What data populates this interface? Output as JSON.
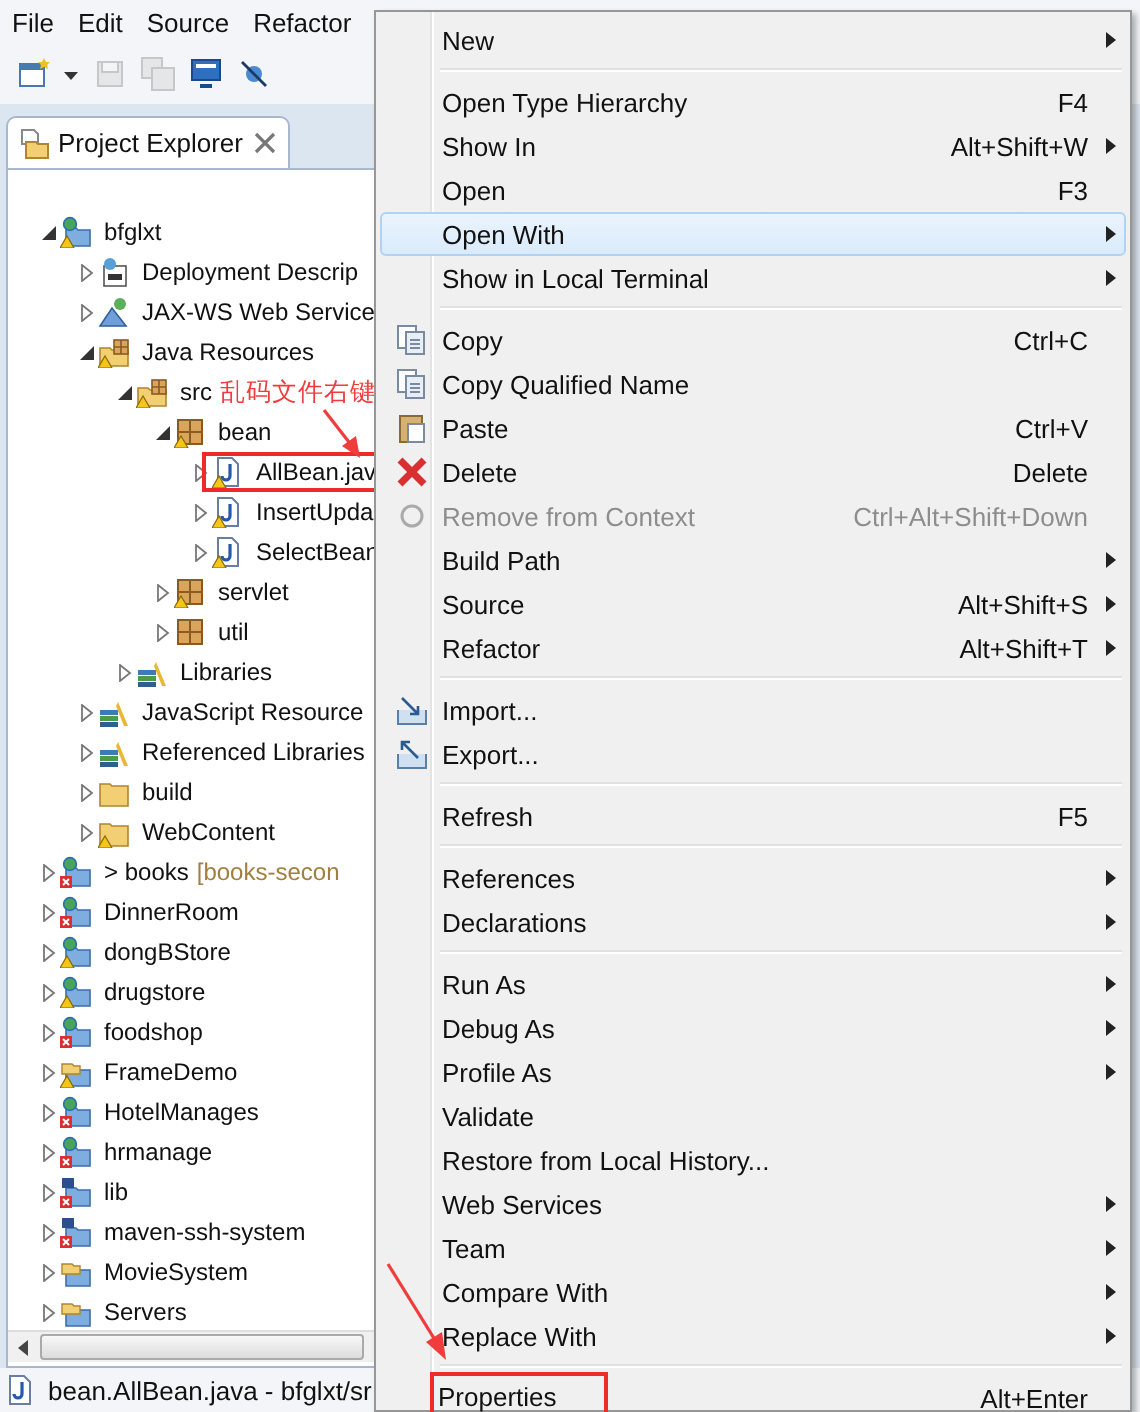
{
  "menubar": [
    "File",
    "Edit",
    "Source",
    "Refactor"
  ],
  "toolbar": [
    {
      "kind": "new",
      "disabled": false
    },
    {
      "kind": "dropdown",
      "disabled": false
    },
    {
      "kind": "save",
      "disabled": true
    },
    {
      "kind": "save-all",
      "disabled": true
    },
    {
      "kind": "monitor",
      "disabled": false
    },
    {
      "kind": "pin",
      "disabled": false
    }
  ],
  "explorer": {
    "tab": "Project Explorer",
    "tree": [
      {
        "label": "bfglxt",
        "kind": "project",
        "warning": true,
        "error": false,
        "expanded": true,
        "marked": false,
        "children": [
          {
            "label": "Deployment Descrip",
            "kind": "deployment",
            "warning": false,
            "error": false,
            "expanded": false,
            "marked": false
          },
          {
            "label": "JAX-WS Web Service",
            "kind": "webservice",
            "warning": false,
            "error": false,
            "expanded": false,
            "marked": false
          },
          {
            "label": "Java Resources",
            "kind": "java-resources",
            "warning": true,
            "error": false,
            "expanded": true,
            "marked": false,
            "children": [
              {
                "label": "src",
                "kind": "source-folder",
                "warning": true,
                "error": false,
                "expanded": true,
                "marked": false,
                "children": [
                  {
                    "label": "bean",
                    "kind": "package",
                    "warning": true,
                    "error": false,
                    "expanded": true,
                    "marked": false,
                    "children": [
                      {
                        "label": "AllBean.jav",
                        "kind": "java-file",
                        "warning": true,
                        "error": false,
                        "expanded": false,
                        "marked": true
                      },
                      {
                        "label": "InsertUpda",
                        "kind": "java-file",
                        "warning": true,
                        "error": false,
                        "expanded": false,
                        "marked": false
                      },
                      {
                        "label": "SelectBean",
                        "kind": "java-file",
                        "warning": true,
                        "error": false,
                        "expanded": false,
                        "marked": false
                      }
                    ]
                  },
                  {
                    "label": "servlet",
                    "kind": "package",
                    "warning": true,
                    "error": false,
                    "expanded": false,
                    "marked": false
                  },
                  {
                    "label": "util",
                    "kind": "package",
                    "warning": false,
                    "error": false,
                    "expanded": false,
                    "marked": false
                  }
                ]
              },
              {
                "label": "Libraries",
                "kind": "library",
                "warning": false,
                "error": false,
                "expanded": false,
                "marked": false
              }
            ]
          },
          {
            "label": "JavaScript Resource",
            "kind": "library",
            "warning": false,
            "error": false,
            "expanded": false,
            "marked": false
          },
          {
            "label": "Referenced Libraries",
            "kind": "library",
            "warning": false,
            "error": false,
            "expanded": false,
            "marked": false
          },
          {
            "label": "build",
            "kind": "folder",
            "warning": false,
            "error": false,
            "expanded": false,
            "marked": false
          },
          {
            "label": "WebContent",
            "kind": "folder",
            "warning": true,
            "error": false,
            "expanded": false,
            "marked": false
          }
        ]
      },
      {
        "label": "> books",
        "decoration": "[books-secon",
        "kind": "project",
        "warning": false,
        "error": true,
        "expanded": false,
        "marked": false
      },
      {
        "label": "DinnerRoom",
        "kind": "project",
        "warning": false,
        "error": true,
        "expanded": false,
        "marked": false
      },
      {
        "label": "dongBStore",
        "kind": "project",
        "warning": true,
        "error": false,
        "expanded": false,
        "marked": false
      },
      {
        "label": "drugstore",
        "kind": "project",
        "warning": true,
        "error": false,
        "expanded": false,
        "marked": false
      },
      {
        "label": "foodshop",
        "kind": "project",
        "warning": false,
        "error": true,
        "expanded": false,
        "marked": false
      },
      {
        "label": "FrameDemo",
        "kind": "plain-project",
        "warning": true,
        "error": false,
        "expanded": false,
        "marked": false
      },
      {
        "label": "HotelManages",
        "kind": "project",
        "warning": false,
        "error": true,
        "expanded": false,
        "marked": false
      },
      {
        "label": "hrmanage",
        "kind": "project",
        "warning": false,
        "error": true,
        "expanded": false,
        "marked": false
      },
      {
        "label": "lib",
        "kind": "maven-project",
        "warning": false,
        "error": true,
        "expanded": false,
        "marked": false
      },
      {
        "label": "maven-ssh-system",
        "kind": "maven-project",
        "warning": false,
        "error": true,
        "expanded": false,
        "marked": false
      },
      {
        "label": "MovieSystem",
        "kind": "plain-project",
        "warning": false,
        "error": false,
        "expanded": false,
        "marked": false
      },
      {
        "label": "Servers",
        "kind": "plain-project",
        "warning": false,
        "error": false,
        "expanded": false,
        "marked": false
      }
    ]
  },
  "context_menu": {
    "items": [
      {
        "kind": "item",
        "label": "New",
        "submenu": true,
        "disabled": false,
        "selected": false,
        "marked": false
      },
      {
        "kind": "separator"
      },
      {
        "kind": "item",
        "label": "Open Type Hierarchy",
        "shortcut": "F4",
        "submenu": false,
        "disabled": false,
        "selected": false,
        "marked": false
      },
      {
        "kind": "item",
        "label": "Show In",
        "shortcut": "Alt+Shift+W",
        "submenu": true,
        "disabled": false,
        "selected": false,
        "marked": false
      },
      {
        "kind": "item",
        "label": "Open",
        "shortcut": "F3",
        "submenu": false,
        "disabled": false,
        "selected": false,
        "marked": false
      },
      {
        "kind": "item",
        "label": "Open With",
        "submenu": true,
        "disabled": false,
        "selected": true,
        "marked": false
      },
      {
        "kind": "item",
        "label": "Show in Local Terminal",
        "submenu": true,
        "disabled": false,
        "selected": false,
        "marked": false
      },
      {
        "kind": "separator"
      },
      {
        "kind": "item",
        "label": "Copy",
        "shortcut": "Ctrl+C",
        "submenu": false,
        "disabled": false,
        "selected": false,
        "marked": false
      },
      {
        "kind": "item",
        "label": "Copy Qualified Name",
        "submenu": false,
        "disabled": false,
        "selected": false,
        "marked": false
      },
      {
        "kind": "item",
        "label": "Paste",
        "shortcut": "Ctrl+V",
        "submenu": false,
        "disabled": false,
        "selected": false,
        "marked": false
      },
      {
        "kind": "item",
        "label": "Delete",
        "shortcut": "Delete",
        "submenu": false,
        "disabled": false,
        "selected": false,
        "marked": false
      },
      {
        "kind": "item",
        "label": "Remove from Context",
        "shortcut": "Ctrl+Alt+Shift+Down",
        "submenu": false,
        "disabled": true,
        "selected": false,
        "marked": false
      },
      {
        "kind": "item",
        "label": "Build Path",
        "submenu": true,
        "disabled": false,
        "selected": false,
        "marked": false
      },
      {
        "kind": "item",
        "label": "Source",
        "shortcut": "Alt+Shift+S",
        "submenu": true,
        "disabled": false,
        "selected": false,
        "marked": false
      },
      {
        "kind": "item",
        "label": "Refactor",
        "shortcut": "Alt+Shift+T",
        "submenu": true,
        "disabled": false,
        "selected": false,
        "marked": false
      },
      {
        "kind": "separator"
      },
      {
        "kind": "item",
        "label": "Import...",
        "submenu": false,
        "disabled": false,
        "selected": false,
        "marked": false
      },
      {
        "kind": "item",
        "label": "Export...",
        "submenu": false,
        "disabled": false,
        "selected": false,
        "marked": false
      },
      {
        "kind": "separator"
      },
      {
        "kind": "item",
        "label": "Refresh",
        "shortcut": "F5",
        "submenu": false,
        "disabled": false,
        "selected": false,
        "marked": false
      },
      {
        "kind": "separator"
      },
      {
        "kind": "item",
        "label": "References",
        "submenu": true,
        "disabled": false,
        "selected": false,
        "marked": false
      },
      {
        "kind": "item",
        "label": "Declarations",
        "submenu": true,
        "disabled": false,
        "selected": false,
        "marked": false
      },
      {
        "kind": "separator"
      },
      {
        "kind": "item",
        "label": "Run As",
        "submenu": true,
        "disabled": false,
        "selected": false,
        "marked": false
      },
      {
        "kind": "item",
        "label": "Debug As",
        "submenu": true,
        "disabled": false,
        "selected": false,
        "marked": false
      },
      {
        "kind": "item",
        "label": "Profile As",
        "submenu": true,
        "disabled": false,
        "selected": false,
        "marked": false
      },
      {
        "kind": "item",
        "label": "Validate",
        "submenu": false,
        "disabled": false,
        "selected": false,
        "marked": false
      },
      {
        "kind": "item",
        "label": "Restore from Local History...",
        "submenu": false,
        "disabled": false,
        "selected": false,
        "marked": false
      },
      {
        "kind": "item",
        "label": "Web Services",
        "submenu": true,
        "disabled": false,
        "selected": false,
        "marked": false
      },
      {
        "kind": "item",
        "label": "Team",
        "submenu": true,
        "disabled": false,
        "selected": false,
        "marked": false
      },
      {
        "kind": "item",
        "label": "Compare With",
        "submenu": true,
        "disabled": false,
        "selected": false,
        "marked": false
      },
      {
        "kind": "item",
        "label": "Replace With",
        "submenu": true,
        "disabled": false,
        "selected": false,
        "marked": false
      },
      {
        "kind": "separator"
      },
      {
        "kind": "item",
        "label": "Properties",
        "shortcut": "Alt+Enter",
        "submenu": false,
        "disabled": false,
        "selected": false,
        "marked": true
      }
    ]
  },
  "annotation": {
    "text": "乱码文件右键"
  },
  "status_bar": "bean.AllBean.java - bfglxt/sr"
}
